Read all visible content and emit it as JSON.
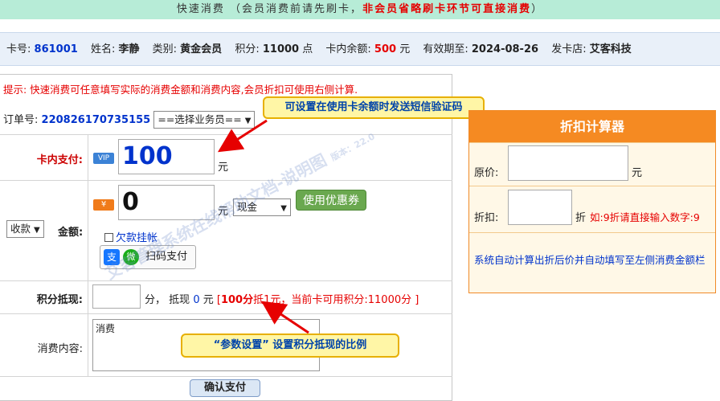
{
  "topbar": {
    "title": "快速消费",
    "note_prefix": "（会员消费前请先刷卡，",
    "note_red": "非会员省略刷卡环节可直接消费",
    "note_suffix": "）"
  },
  "member_info": {
    "card_no_label": "卡号:",
    "card_no": "861001",
    "name_label": "姓名:",
    "name": "李静",
    "type_label": "类别:",
    "type": "黄金会员",
    "points_label": "积分:",
    "points": "11000",
    "points_unit": "点",
    "balance_label": "卡内余额:",
    "balance": "500",
    "balance_unit": "元",
    "expiry_label": "有效期至:",
    "expiry": "2024-08-26",
    "store_label": "发卡店:",
    "store": "艾客科技"
  },
  "form": {
    "tip": "提示: 快速消费可任意填写实际的消费金额和消费内容,会员折扣可使用右侧计算.",
    "order_label": "订单号:",
    "order_no": "220826170735155",
    "staff_select": "==选择业务员==",
    "card_pay_label": "卡内支付:",
    "vip_badge": "VIP",
    "card_pay_value": "100",
    "yuan": "元",
    "receive_select": "收款",
    "amount_label": "金额:",
    "yen_badge": "¥",
    "amount_value": "0",
    "method_select": "现金",
    "coupon_button": "使用优惠券",
    "credit_checkbox": "欠款挂帐",
    "alipay_icon": "支",
    "wechat_icon": "微",
    "scan_pay": "扫码支付",
    "points_label": "积分抵现:",
    "points_unit": "分，",
    "points_offset_label": "抵现",
    "points_offset_value": "0",
    "points_rule_prefix": "[",
    "points_rule_strong": "100分",
    "points_rule_text": "抵1元，当前卡可用积分:11000分 ]",
    "content_label": "消费内容:",
    "content_value": "消费",
    "confirm_button": "确认支付"
  },
  "callouts": {
    "sms": "可设置在使用卡余额时发送短信验证码",
    "points": "“参数设置” 设置积分抵现的比例"
  },
  "watermark": {
    "text": "艾客管理系统在线帮助文档-说明图",
    "version": "版本：22.0"
  },
  "calculator": {
    "title": "折扣计算器",
    "original_label": "原价:",
    "original_unit": "元",
    "discount_label": "折扣:",
    "discount_unit": "折",
    "discount_hint": "如:9折请直接输入数字:9",
    "auto_hint": "系统自动计算出折后价并自动填写至左侧消费金额栏"
  },
  "colors": {
    "topbar_bg": "#b7ecd7",
    "accent_red": "#e60000",
    "accent_blue": "#0033cc",
    "calc_orange": "#f58a22",
    "callout_yellow": "#fff6a6",
    "arrow_red": "#e60000"
  }
}
